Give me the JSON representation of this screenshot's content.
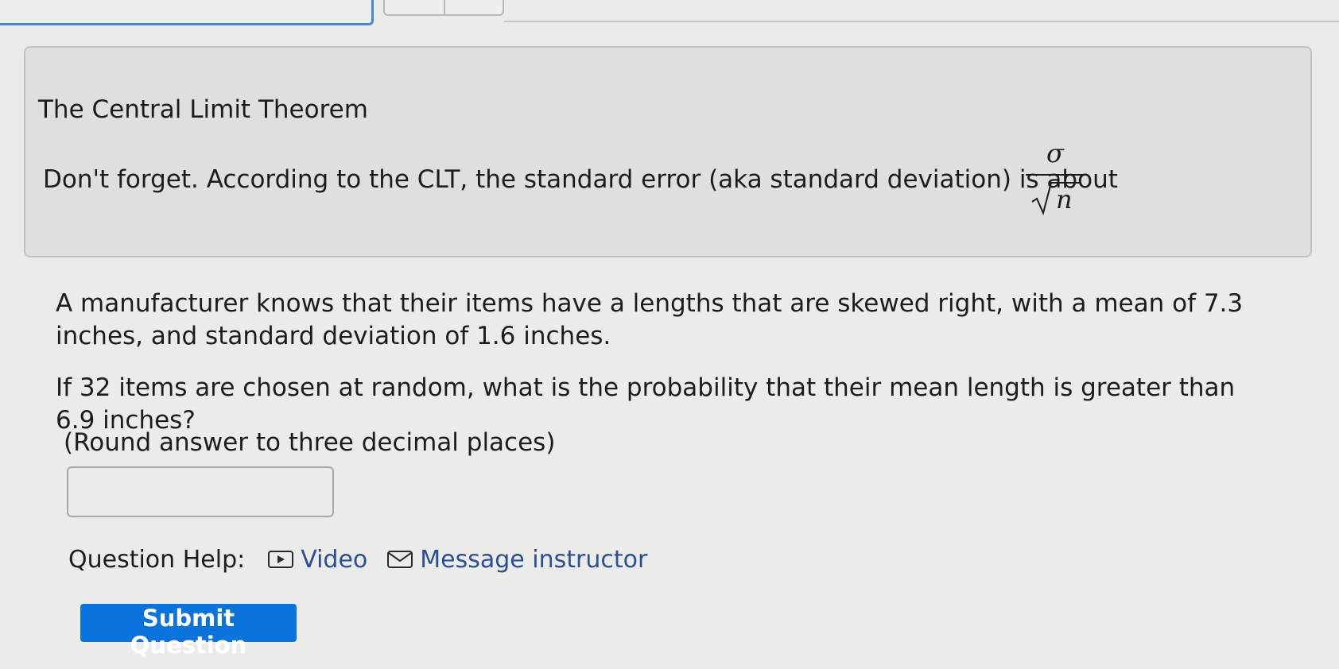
{
  "info": {
    "title": "The Central Limit Theorem",
    "text": "Don't forget. According to the CLT, the standard error (aka standard deviation) is about",
    "formula_numerator": "σ",
    "formula_denominator_symbol": "n"
  },
  "question": {
    "paragraph1": "A manufacturer knows that their items have a lengths that are skewed right, with a mean of 7.3 inches, and standard deviation of 1.6 inches.",
    "paragraph2": "If 32 items are chosen at random, what is the probability that their mean length is greater than 6.9 inches?",
    "paragraph3": "(Round answer to three decimal places)"
  },
  "answer": {
    "value": "",
    "placeholder": ""
  },
  "help": {
    "label": "Question Help:",
    "video_label": "Video",
    "message_label": "Message instructor",
    "icons": [
      "video-icon",
      "mail-icon"
    ],
    "link_color": "#2a4f9a"
  },
  "submit": {
    "label": "Submit Question",
    "color": "#0a74dc"
  }
}
